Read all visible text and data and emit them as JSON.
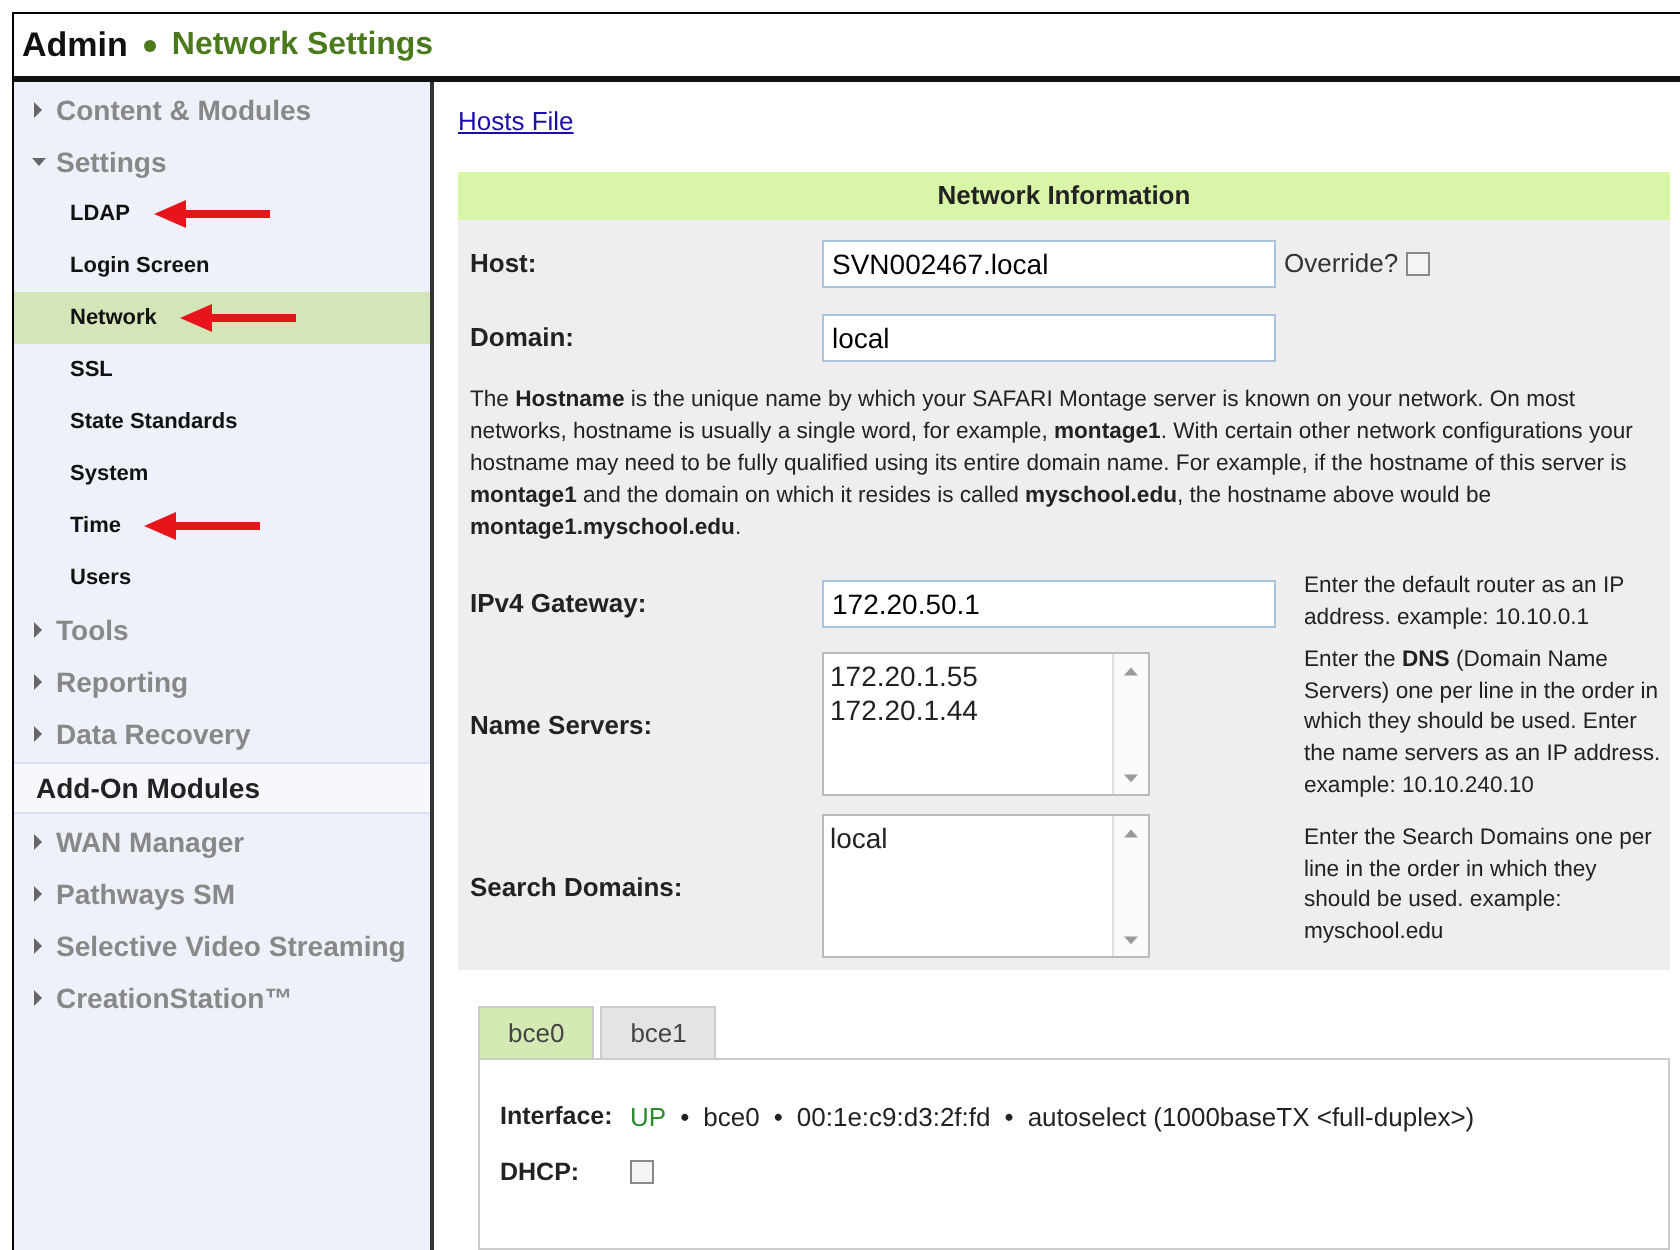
{
  "header": {
    "section": "Admin",
    "page": "Network Settings"
  },
  "sidebar": {
    "items": [
      {
        "kind": "group",
        "label": "Content & Modules",
        "expanded": false
      },
      {
        "kind": "group",
        "label": "Settings",
        "expanded": true,
        "children": [
          {
            "label": "LDAP",
            "selected": false,
            "arrow": true
          },
          {
            "label": "Login Screen",
            "selected": false,
            "arrow": false
          },
          {
            "label": "Network",
            "selected": true,
            "arrow": true
          },
          {
            "label": "SSL",
            "selected": false,
            "arrow": false
          },
          {
            "label": "State Standards",
            "selected": false,
            "arrow": false
          },
          {
            "label": "System",
            "selected": false,
            "arrow": false
          },
          {
            "label": "Time",
            "selected": false,
            "arrow": true
          },
          {
            "label": "Users",
            "selected": false,
            "arrow": false
          }
        ]
      },
      {
        "kind": "group",
        "label": "Tools",
        "expanded": false
      },
      {
        "kind": "group",
        "label": "Reporting",
        "expanded": false
      },
      {
        "kind": "group",
        "label": "Data Recovery",
        "expanded": false
      },
      {
        "kind": "heading",
        "label": "Add-On Modules"
      },
      {
        "kind": "group",
        "label": "WAN Manager",
        "expanded": false
      },
      {
        "kind": "group",
        "label": "Pathways SM",
        "expanded": false
      },
      {
        "kind": "group",
        "label": "Selective Video Streaming",
        "expanded": false
      },
      {
        "kind": "group",
        "label": "CreationStation™",
        "expanded": false
      }
    ]
  },
  "hosts_link": "Hosts File",
  "panel": {
    "title": "Network Information",
    "rows": [
      {
        "kind": "text",
        "label": "Host:",
        "value": "SVN002467.local",
        "option": {
          "label": "Override?",
          "checked": false
        }
      },
      {
        "kind": "text",
        "label": "Domain:",
        "value": "local"
      },
      {
        "kind": "note",
        "text": "The **Hostname** is the unique name by which your SAFARI Montage server is known on your network. On most networks, hostname is usually a single word, for example, **montage1**. With certain other network configurations your hostname may need to be fully qualified using its entire domain name. For example, if the hostname of this server is **montage1** and the domain on which it resides is called **myschool.edu**, the hostname above would be **montage1.myschool.edu**."
      },
      {
        "kind": "text",
        "label": "IPv4 Gateway:",
        "value": "172.20.50.1",
        "help": "Enter the default router as an IP address. example: 10.10.0.1"
      },
      {
        "kind": "textarea",
        "label": "Name Servers:",
        "lines": [
          "172.20.1.55",
          "172.20.1.44"
        ],
        "help": "Enter the **DNS** (Domain Name Servers) one per line in the order in which they should be used. Enter the name servers as an IP address. example: 10.10.240.10"
      },
      {
        "kind": "textarea",
        "label": "Search Domains:",
        "lines": [
          "local"
        ],
        "help": "Enter the Search Domains one per line in the order in which they should be used. example: myschool.edu"
      }
    ],
    "tabs": [
      {
        "label": "bce0",
        "selected": true
      },
      {
        "label": "bce1",
        "selected": false
      }
    ],
    "interface": {
      "label": "Interface:",
      "status": "UP",
      "separator": "•",
      "parts": [
        "bce0",
        "00:1e:c9:d3:2f:fd",
        "autoselect (1000baseTX <full-duplex>)"
      ]
    },
    "dhcp": {
      "label": "DHCP:",
      "checked": false
    }
  }
}
